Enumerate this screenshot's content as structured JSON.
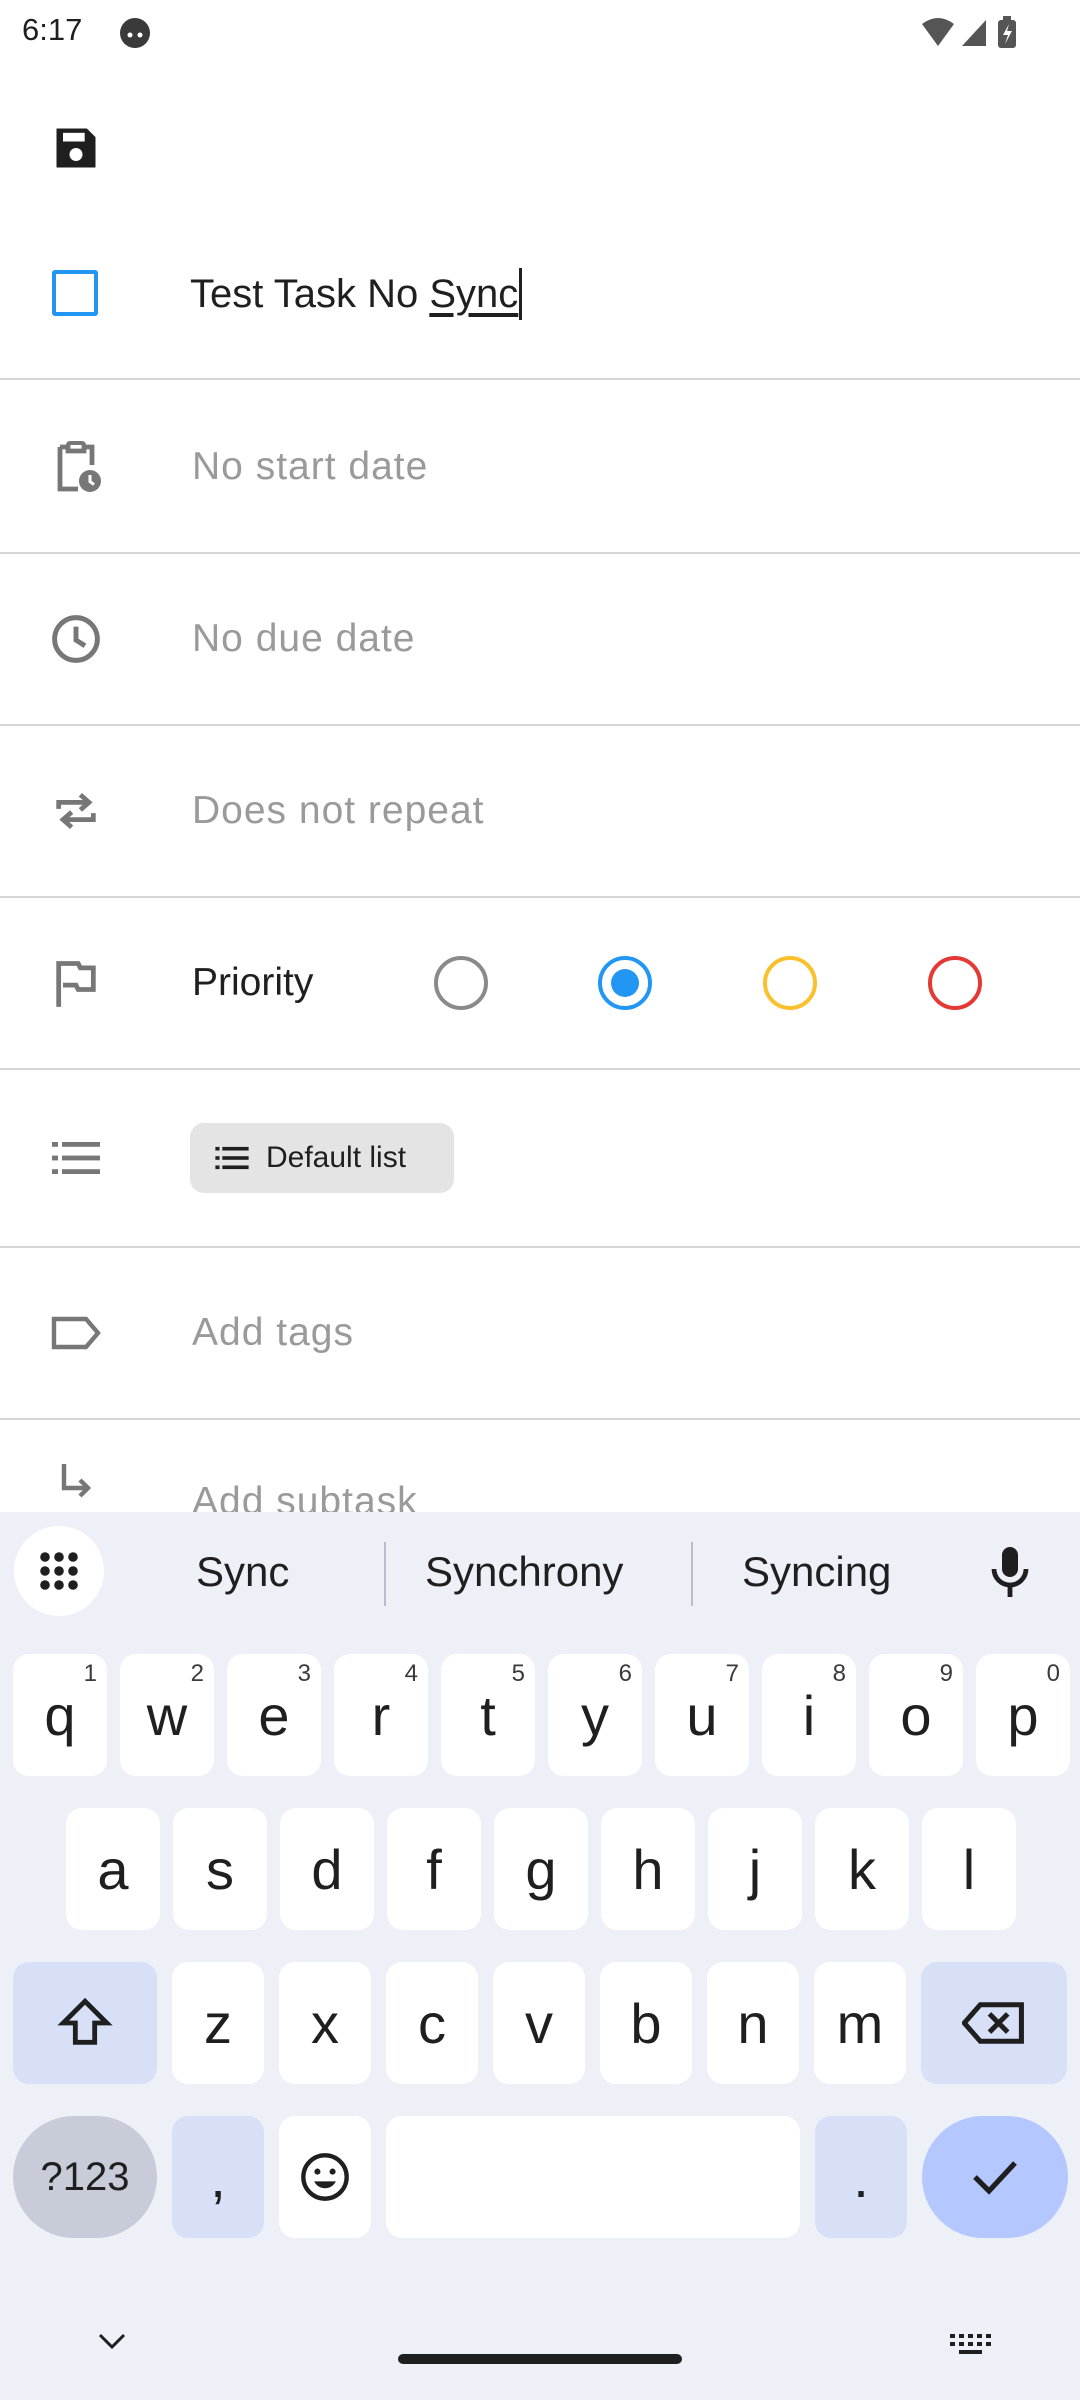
{
  "status": {
    "time": "6:17"
  },
  "task": {
    "title_prefix": "Test Task No ",
    "title_underlined": "Sync"
  },
  "rows": {
    "start_date": "No start date",
    "due_date": "No due date",
    "repeat": "Does not repeat",
    "priority_label": "Priority",
    "list_chip": "Default list",
    "tags": "Add tags",
    "subtask": "Add subtask"
  },
  "priority_options": [
    {
      "color": "#8a8a8a",
      "selected": false
    },
    {
      "color": "#2196f3",
      "selected": true
    },
    {
      "color": "#fbc02d",
      "selected": false
    },
    {
      "color": "#e53935",
      "selected": false
    }
  ],
  "keyboard": {
    "suggestions": [
      "Sync",
      "Synchrony",
      "Syncing"
    ],
    "row1": [
      {
        "k": "q",
        "h": "1"
      },
      {
        "k": "w",
        "h": "2"
      },
      {
        "k": "e",
        "h": "3"
      },
      {
        "k": "r",
        "h": "4"
      },
      {
        "k": "t",
        "h": "5"
      },
      {
        "k": "y",
        "h": "6"
      },
      {
        "k": "u",
        "h": "7"
      },
      {
        "k": "i",
        "h": "8"
      },
      {
        "k": "o",
        "h": "9"
      },
      {
        "k": "p",
        "h": "0"
      }
    ],
    "row2": [
      "a",
      "s",
      "d",
      "f",
      "g",
      "h",
      "j",
      "k",
      "l"
    ],
    "row3": [
      "z",
      "x",
      "c",
      "v",
      "b",
      "n",
      "m"
    ],
    "symbols_label": "?123",
    "comma": ",",
    "period": "."
  },
  "colors": {
    "accent": "#2196f3",
    "divider": "#d6d6d6",
    "hint_text": "#9a9a9a",
    "keyboard_bg": "#eef0f8"
  }
}
